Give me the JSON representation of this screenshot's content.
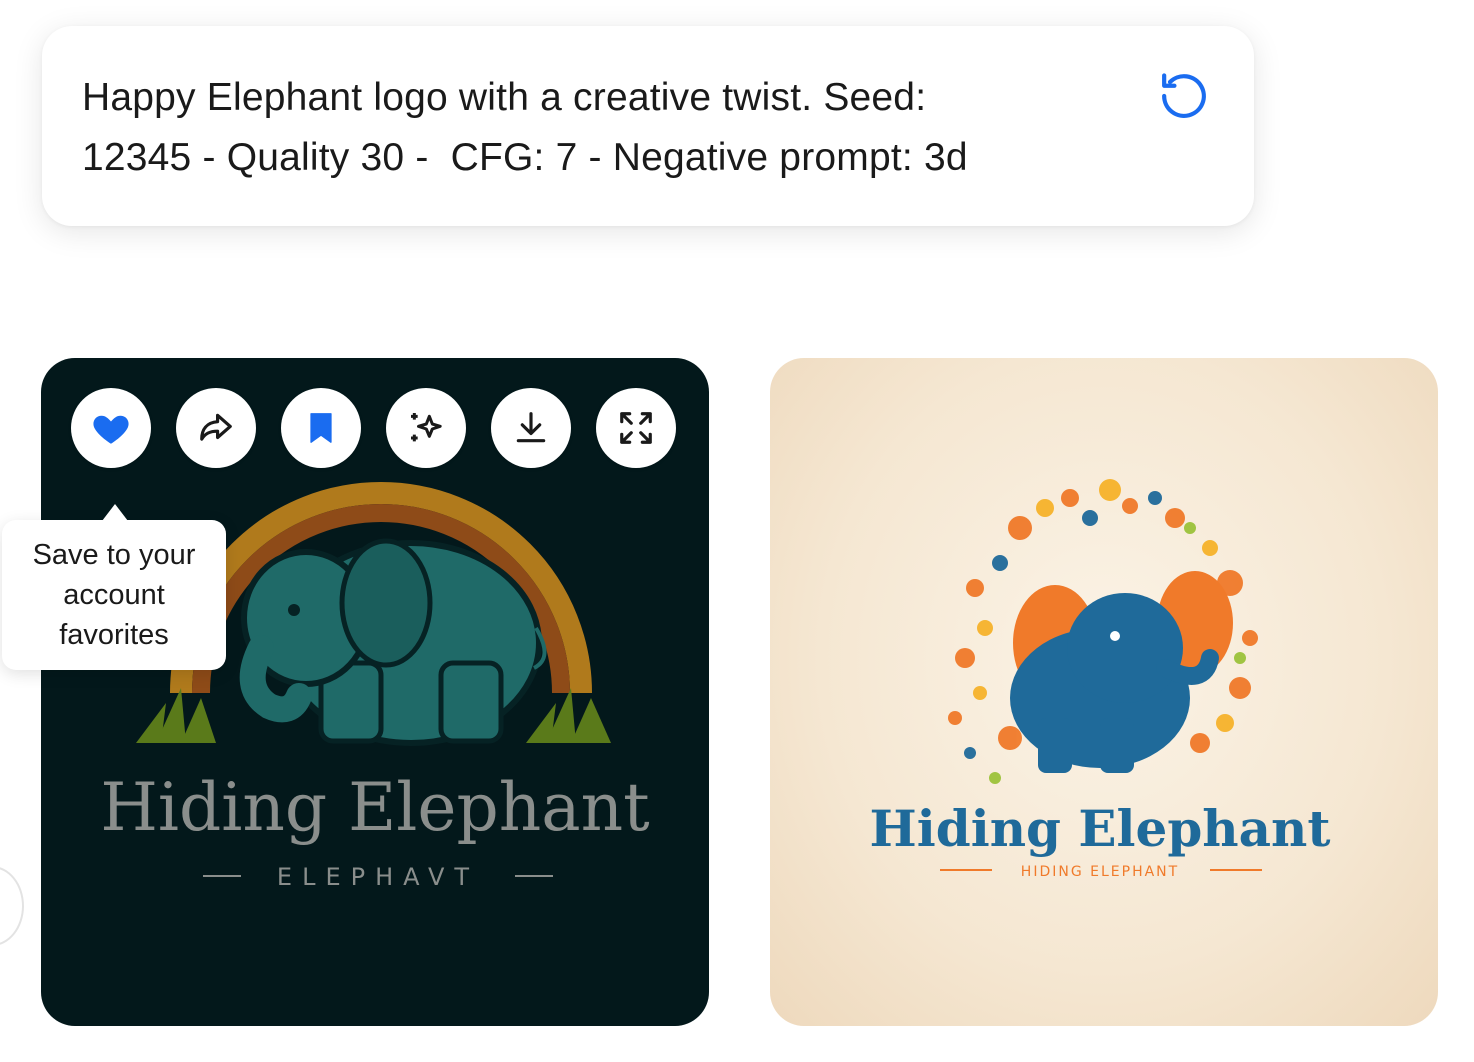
{
  "prompt": {
    "text": "Happy Elephant logo with a creative twist. Seed:\n12345 - Quality 30 -  CFG: 7 - Negative prompt: 3d",
    "regenerate_icon": "refresh-icon"
  },
  "toolbar": {
    "buttons": [
      {
        "name": "favorite-button",
        "icon": "heart-icon"
      },
      {
        "name": "share-button",
        "icon": "share-arrow-icon"
      },
      {
        "name": "bookmark-button",
        "icon": "bookmark-icon"
      },
      {
        "name": "enhance-button",
        "icon": "sparkles-icon"
      },
      {
        "name": "download-button",
        "icon": "download-icon"
      },
      {
        "name": "fullscreen-button",
        "icon": "expand-icon"
      }
    ]
  },
  "tooltip": {
    "text": "Save to your account favorites"
  },
  "images": [
    {
      "title": "Hiding Elephant",
      "subtitle": "ELEPHAVT",
      "background": "#03181b"
    },
    {
      "title": "Hiding Elephant",
      "subtitle": "HIDING ELEPHANT",
      "background": "#f5e7d2"
    }
  ],
  "colors": {
    "accent": "#1a6cf0",
    "elephant_teal": "#1f6a68",
    "elephant_blue": "#1f6a9a"
  }
}
